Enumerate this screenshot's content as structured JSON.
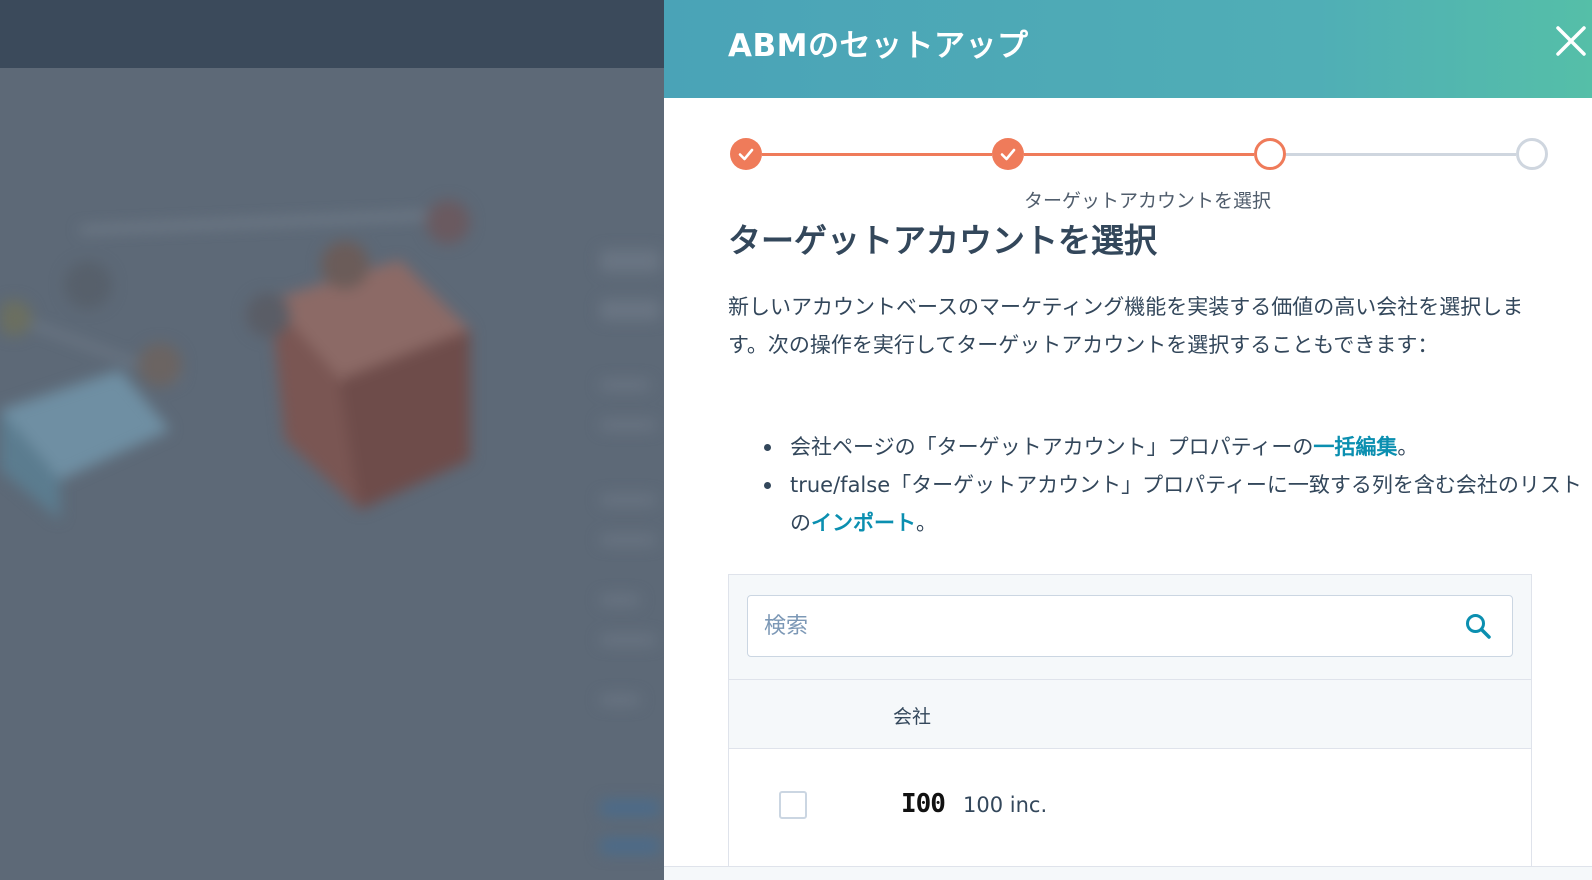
{
  "panel": {
    "title": "ABMのセットアップ",
    "close_label": "×"
  },
  "stepper": {
    "steps": [
      {
        "status": "done"
      },
      {
        "status": "done"
      },
      {
        "status": "current",
        "label": "ターゲットアカウントを選択"
      },
      {
        "status": "todo"
      }
    ],
    "colors": {
      "done": "#ef7b5a",
      "todo": "#cfd6df"
    }
  },
  "section": {
    "title": "ターゲットアカウントを選択",
    "description": "新しいアカウントベースのマーケティング機能を実装する価値の高い会社を選択します。次の操作を実行してターゲットアカウントを選択することもできます：",
    "bullets": [
      {
        "before": "会社ページの「ターゲットアカウント」プロパティーの",
        "link": "一括編集",
        "after": "。"
      },
      {
        "before": "true/false「ターゲットアカウント」プロパティーに一致する列を含む会社のリストの",
        "link": "インポート",
        "after": "。"
      }
    ]
  },
  "search": {
    "placeholder": "検索",
    "value": ""
  },
  "table": {
    "columns": [
      "会社"
    ],
    "rows": [
      {
        "logo_text": "I00",
        "name": "100 inc.",
        "checked": false
      }
    ]
  },
  "colors": {
    "accent": "#ef7b5a",
    "link": "#0b8fb0",
    "header_start": "#4aa3b7",
    "header_end": "#55bfa8",
    "text": "#33475b"
  }
}
